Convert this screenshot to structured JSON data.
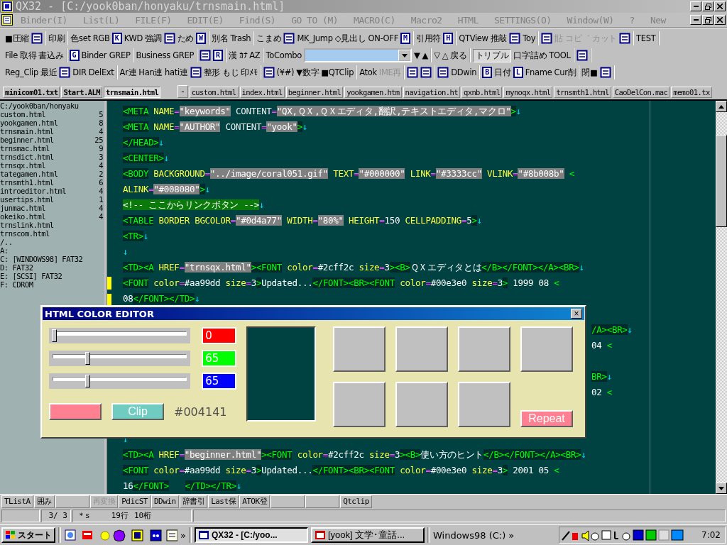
{
  "window": {
    "title": "QX32 - [C:/yook0ban/honyaku/trnsmain.html]"
  },
  "menu": [
    "Binder(I)",
    "List(L)",
    "FILE(F)",
    "EDIT(E)",
    "Find(S)",
    "GO TO (M)",
    "MACRO(C)",
    "Macro2",
    "HTML",
    "SETTINGS(O)",
    "Window(W)",
    "?",
    "New"
  ],
  "toolbars": [
    {
      "groups": [
        {
          "items": [
            {
              "kind": "text",
              "label": "■圧縮"
            },
            {
              "kind": "icon"
            }
          ]
        },
        {
          "items": [
            {
              "kind": "text",
              "label": "印刷"
            }
          ]
        },
        {
          "items": [
            {
              "kind": "text",
              "label": "色set"
            },
            {
              "kind": "text",
              "label": "RGB"
            },
            {
              "kind": "key",
              "label": "K"
            },
            {
              "kind": "text",
              "label": "KWD"
            },
            {
              "kind": "text",
              "label": "強調"
            },
            {
              "kind": "icon"
            },
            {
              "kind": "text",
              "label": "ため"
            },
            {
              "kind": "key",
              "label": "W"
            }
          ]
        },
        {
          "items": [
            {
              "kind": "text",
              "label": "別名"
            },
            {
              "kind": "text",
              "label": "Trash"
            }
          ]
        },
        {
          "items": [
            {
              "kind": "text",
              "label": "こまめ"
            },
            {
              "kind": "icon"
            },
            {
              "kind": "text",
              "label": "MK_Jump"
            },
            {
              "kind": "text",
              "label": "◇見出し"
            },
            {
              "kind": "text",
              "label": "ON-OFF"
            },
            {
              "kind": "key",
              "label": "M"
            }
          ]
        },
        {
          "items": [
            {
              "kind": "text",
              "label": "引用符"
            },
            {
              "kind": "key",
              "label": "H"
            }
          ]
        },
        {
          "items": [
            {
              "kind": "text",
              "label": "QTView"
            },
            {
              "kind": "text",
              "label": "推敲"
            },
            {
              "kind": "icon"
            },
            {
              "kind": "text",
              "label": "Toy"
            }
          ]
        },
        {
          "items": [
            {
              "kind": "icon",
              "disabled": false
            },
            {
              "kind": "text",
              "label": "貼",
              "disabled": true
            },
            {
              "kind": "text",
              "label": "コピ゛",
              "disabled": true
            },
            {
              "kind": "text",
              "label": "カット",
              "disabled": true
            },
            {
              "kind": "icon",
              "disabled": false
            }
          ]
        },
        {
          "items": [
            {
              "kind": "text",
              "label": "TEST"
            }
          ]
        }
      ]
    },
    {
      "groups": [
        {
          "items": [
            {
              "kind": "text",
              "label": "File"
            },
            {
              "kind": "text",
              "label": "取得"
            },
            {
              "kind": "text",
              "label": "書込み"
            }
          ]
        },
        {
          "items": [
            {
              "kind": "key",
              "label": "G"
            },
            {
              "kind": "text",
              "label": "Binder GREP"
            }
          ]
        },
        {
          "items": [
            {
              "kind": "text",
              "label": "Business GREP"
            }
          ]
        },
        {
          "items": [
            {
              "kind": "icon"
            },
            {
              "kind": "key",
              "label": "R"
            }
          ]
        },
        {
          "items": [
            {
              "kind": "text",
              "label": "漢"
            },
            {
              "kind": "text",
              "label": "ｶﾅ"
            },
            {
              "kind": "text",
              "label": "AZ"
            }
          ]
        },
        {
          "items": [
            {
              "kind": "text",
              "label": "ToCombo"
            },
            {
              "kind": "combo"
            },
            {
              "kind": "text",
              "label": "▼"
            },
            {
              "kind": "text",
              "label": "▲"
            }
          ]
        },
        {
          "items": [
            {
              "kind": "text",
              "label": "▽"
            },
            {
              "kind": "text",
              "label": "△"
            },
            {
              "kind": "text",
              "label": "戻る"
            }
          ]
        },
        {
          "items": [
            {
              "kind": "text",
              "label": "トリプル",
              "pressed": true
            },
            {
              "kind": "text",
              "label": "口字詰め",
              "pressed": false
            },
            {
              "kind": "text",
              "label": "TOOL",
              "pressed": false
            }
          ]
        },
        {
          "items": [
            {
              "kind": "icon"
            }
          ]
        }
      ]
    },
    {
      "groups": [
        {
          "items": [
            {
              "kind": "text",
              "label": "Reg_Clip"
            },
            {
              "kind": "text",
              "label": "最近"
            },
            {
              "kind": "icon"
            },
            {
              "kind": "text",
              "label": "DIR"
            },
            {
              "kind": "text",
              "label": "DelExt"
            }
          ]
        },
        {
          "items": [
            {
              "kind": "text",
              "label": "Ar連"
            },
            {
              "kind": "text",
              "label": "Han連"
            },
            {
              "kind": "text",
              "label": "hati連"
            },
            {
              "kind": "icon"
            },
            {
              "kind": "text",
              "label": "整形"
            },
            {
              "kind": "text",
              "label": "もじ"
            },
            {
              "kind": "text",
              "label": "印ﾒﾓ"
            }
          ]
        },
        {
          "items": [
            {
              "kind": "icon"
            },
            {
              "kind": "text",
              "label": "(¥#)"
            },
            {
              "kind": "text",
              "label": "▼数字"
            },
            {
              "kind": "text",
              "label": "■QTClip"
            }
          ]
        },
        {
          "items": [
            {
              "kind": "text",
              "label": "Atok",
              "disabled": false
            },
            {
              "kind": "text",
              "label": "IME再",
              "disabled": true
            }
          ]
        },
        {
          "items": [
            {
              "kind": "icon"
            },
            {
              "kind": "icon"
            }
          ]
        },
        {
          "items": [
            {
              "kind": "icon"
            },
            {
              "kind": "text",
              "label": "DDwin"
            }
          ]
        },
        {
          "items": [
            {
              "kind": "key",
              "label": "B"
            },
            {
              "kind": "text",
              "label": "日付"
            },
            {
              "kind": "key",
              "label": "L"
            },
            {
              "kind": "text",
              "label": "Fname"
            },
            {
              "kind": "text",
              "label": "Cur削"
            }
          ]
        },
        {
          "items": [
            {
              "kind": "text",
              "label": "閉■"
            },
            {
              "kind": "icon"
            }
          ]
        }
      ]
    }
  ],
  "tabs_left": [
    {
      "label": "minicom01.txt",
      "selected": false
    },
    {
      "label": "Start.ALM",
      "selected": false
    },
    {
      "label": "trnsmain.html",
      "selected": true
    }
  ],
  "tab_menu_button": "-",
  "tabs_right": [
    {
      "label": "custom.html",
      "selected": false
    },
    {
      "label": "index.html",
      "selected": false
    },
    {
      "label": "beginner.html",
      "selected": false
    },
    {
      "label": "yookgamen.htm",
      "selected": false
    },
    {
      "label": "navigation.ht",
      "selected": false
    },
    {
      "label": "qxnb.html",
      "selected": false
    },
    {
      "label": "mynoqx.html",
      "selected": false
    },
    {
      "label": "trnsmth1.html",
      "selected": false
    },
    {
      "label": "CaoDelCon.mac",
      "selected": false
    },
    {
      "label": "memo01.tx",
      "selected": false
    }
  ],
  "sidebar": {
    "path": "C:/yook0ban/honyaku",
    "files": [
      {
        "name": "custom.html",
        "size": "5"
      },
      {
        "name": "yookgamen.html",
        "size": "8"
      },
      {
        "name": "trnsmain.html",
        "size": "4"
      },
      {
        "name": "beginner.html",
        "size": "25"
      },
      {
        "name": "trnsmac.html",
        "size": "9"
      },
      {
        "name": "trnsdict.html",
        "size": "3"
      },
      {
        "name": "trnsqx.html",
        "size": "4"
      },
      {
        "name": "tategamen.html",
        "size": "2"
      },
      {
        "name": "trnsmth1.html",
        "size": "6"
      },
      {
        "name": "introeditor.html",
        "size": "4"
      },
      {
        "name": "usertips.html",
        "size": "1"
      },
      {
        "name": "junmac.html",
        "size": "4"
      },
      {
        "name": "okeiko.html",
        "size": "4"
      },
      {
        "name": "trnslink.html"
      },
      {
        "name": "trnscom.html"
      }
    ],
    "drives": [
      "/..",
      "A:",
      "C: [WINDOWS98] FAT32",
      "D: FAT32",
      "E: [SCSI] FAT32",
      "F: CDROM"
    ]
  },
  "editor": {
    "lines": [
      {
        "kind": "code",
        "marked": false,
        "tokens": [
          {
            "kind": "tag",
            "text": "<META"
          },
          {
            "kind": "attr",
            "text": " NAME"
          },
          {
            "kind": "eq",
            "text": "="
          },
          {
            "kind": "val",
            "text": "\"keywords\""
          },
          {
            "kind": "word",
            "text": " CONTENT"
          },
          {
            "kind": "eq",
            "text": "="
          },
          {
            "kind": "val",
            "text": "\"QX,ＱＸ,ＱＸエディタ,翻訳,テキストエディタ,マクロ\""
          },
          {
            "kind": "tag",
            "text": ">"
          },
          {
            "kind": "nl",
            "text": "↓"
          }
        ]
      },
      {
        "kind": "code",
        "marked": false,
        "tokens": [
          {
            "kind": "tag",
            "text": "<META"
          },
          {
            "kind": "attr",
            "text": " NAME"
          },
          {
            "kind": "eq",
            "text": "="
          },
          {
            "kind": "val",
            "text": "\"AUTHOR\""
          },
          {
            "kind": "word",
            "text": " CONTENT"
          },
          {
            "kind": "eq",
            "text": "="
          },
          {
            "kind": "val",
            "text": "\"yook\""
          },
          {
            "kind": "tag",
            "text": ">"
          },
          {
            "kind": "nl",
            "text": "↓"
          }
        ]
      },
      {
        "kind": "code",
        "marked": false,
        "tokens": [
          {
            "kind": "tag",
            "text": "</HEAD>"
          },
          {
            "kind": "nl",
            "text": "↓"
          }
        ]
      },
      {
        "kind": "code",
        "marked": false,
        "tokens": [
          {
            "kind": "tag",
            "text": "<CENTER>"
          },
          {
            "kind": "nl",
            "text": "↓"
          }
        ]
      },
      {
        "kind": "code",
        "marked": false,
        "tokens": [
          {
            "kind": "tag",
            "text": "<BODY"
          },
          {
            "kind": "attr",
            "text": " BACKGROUND"
          },
          {
            "kind": "eq",
            "text": "="
          },
          {
            "kind": "val",
            "text": "\"../image/coral051.gif\""
          },
          {
            "kind": "attr",
            "text": " TEXT"
          },
          {
            "kind": "eq",
            "text": "="
          },
          {
            "kind": "val",
            "text": "\"#000000\""
          },
          {
            "kind": "attr",
            "text": " LINK"
          },
          {
            "kind": "eq",
            "text": "="
          },
          {
            "kind": "val",
            "text": "\"#3333cc\""
          },
          {
            "kind": "attr",
            "text": " VLINK"
          },
          {
            "kind": "eq",
            "text": "="
          },
          {
            "kind": "val",
            "text": "\"#8b008b\""
          },
          {
            "kind": "tagplain",
            "text": " <"
          }
        ]
      },
      {
        "kind": "code",
        "marked": false,
        "tokens": [
          {
            "kind": "attr",
            "text": "ALINK"
          },
          {
            "kind": "eq",
            "text": "="
          },
          {
            "kind": "val",
            "text": "\"#008080\""
          },
          {
            "kind": "tag",
            "text": ">"
          },
          {
            "kind": "nl",
            "text": "↓"
          }
        ]
      },
      {
        "kind": "code",
        "marked": false,
        "tokens": [
          {
            "kind": "comment",
            "text": "<!-- ここからリンクボタン -->"
          },
          {
            "kind": "nl",
            "text": "↓"
          }
        ]
      },
      {
        "kind": "code",
        "marked": false,
        "tokens": [
          {
            "kind": "tag",
            "text": "<TABLE"
          },
          {
            "kind": "attr",
            "text": " BORDER BGCOLOR"
          },
          {
            "kind": "eq",
            "text": "="
          },
          {
            "kind": "val",
            "text": "\"#0d4a77\""
          },
          {
            "kind": "attr",
            "text": " WIDTH"
          },
          {
            "kind": "eq",
            "text": "="
          },
          {
            "kind": "val",
            "text": "\"80%\""
          },
          {
            "kind": "attr",
            "text": " HEIGHT"
          },
          {
            "kind": "eq",
            "text": "="
          },
          {
            "kind": "plain",
            "text": "150"
          },
          {
            "kind": "attr",
            "text": " CELLPADDING"
          },
          {
            "kind": "eq",
            "text": "="
          },
          {
            "kind": "plain",
            "text": "5"
          },
          {
            "kind": "tag",
            "text": ">"
          },
          {
            "kind": "nl",
            "text": "↓"
          }
        ]
      },
      {
        "kind": "code",
        "marked": false,
        "tokens": [
          {
            "kind": "tag",
            "text": "<TR>"
          },
          {
            "kind": "nl",
            "text": "↓"
          }
        ]
      },
      {
        "kind": "code",
        "marked": false,
        "tokens": [
          {
            "kind": "nl",
            "text": "↓"
          }
        ]
      },
      {
        "kind": "code",
        "marked": false,
        "tokens": [
          {
            "kind": "tag",
            "text": "<TD><A"
          },
          {
            "kind": "attr",
            "text": " HREF"
          },
          {
            "kind": "eq",
            "text": "="
          },
          {
            "kind": "val",
            "text": "\"trnsqx.html\""
          },
          {
            "kind": "tag",
            "text": "><FONT"
          },
          {
            "kind": "attr",
            "text": " color"
          },
          {
            "kind": "eq",
            "text": "="
          },
          {
            "kind": "plain",
            "text": "#2cff2c"
          },
          {
            "kind": "attr",
            "text": " size"
          },
          {
            "kind": "eq",
            "text": "="
          },
          {
            "kind": "plain",
            "text": "3"
          },
          {
            "kind": "tag",
            "text": "><B>"
          },
          {
            "kind": "plain",
            "text": "ＱＸエディタとは"
          },
          {
            "kind": "tag",
            "text": "</B></FONT></A><BR>"
          },
          {
            "kind": "nl",
            "text": "↓"
          }
        ]
      },
      {
        "kind": "code",
        "marked": true,
        "tokens": [
          {
            "kind": "tag",
            "text": "<FONT"
          },
          {
            "kind": "attr",
            "text": " color"
          },
          {
            "kind": "eq",
            "text": "="
          },
          {
            "kind": "plain",
            "text": "#aa99dd"
          },
          {
            "kind": "attr",
            "text": " size"
          },
          {
            "kind": "eq",
            "text": "="
          },
          {
            "kind": "plain",
            "text": "3"
          },
          {
            "kind": "tag",
            "text": ">"
          },
          {
            "kind": "plain",
            "text": "Updated..."
          },
          {
            "kind": "tag",
            "text": "</FONT><BR><FONT"
          },
          {
            "kind": "attr",
            "text": " color"
          },
          {
            "kind": "eq",
            "text": "="
          },
          {
            "kind": "plain",
            "text": "#00e3e0"
          },
          {
            "kind": "attr",
            "text": " size"
          },
          {
            "kind": "eq",
            "text": "="
          },
          {
            "kind": "plain",
            "text": "3"
          },
          {
            "kind": "tag",
            "text": ">"
          },
          {
            "kind": "plain",
            "text": " 1999 08 "
          },
          {
            "kind": "tagplain",
            "text": "<"
          }
        ]
      },
      {
        "kind": "code",
        "marked": true,
        "tokens": [
          {
            "kind": "plain",
            "text": "08"
          },
          {
            "kind": "tag",
            "text": "</FONT></TD>"
          },
          {
            "kind": "nl",
            "text": "↓"
          }
        ]
      },
      {
        "kind": "covered"
      },
      {
        "kind": "covered",
        "marked": false,
        "tokens": [
          {
            "kind": "tag",
            "text": "/A><BR>"
          },
          {
            "kind": "nl",
            "text": "↓"
          }
        ]
      },
      {
        "kind": "covered",
        "marked": false,
        "tokens": [
          {
            "kind": "plain",
            "text": "04 "
          },
          {
            "kind": "tagplain",
            "text": "<"
          }
        ]
      },
      {
        "kind": "covered"
      },
      {
        "kind": "covered",
        "marked": false,
        "tokens": [
          {
            "kind": "tag",
            "text": "BR>"
          },
          {
            "kind": "nl",
            "text": "↓"
          }
        ]
      },
      {
        "kind": "covered",
        "marked": false,
        "tokens": [
          {
            "kind": "plain",
            "text": "02 "
          },
          {
            "kind": "tagplain",
            "text": "<"
          }
        ]
      },
      {
        "kind": "covered"
      },
      {
        "kind": "covered"
      },
      {
        "kind": "code",
        "marked": false,
        "tokens": [
          {
            "kind": "nl",
            "text": "↓"
          }
        ]
      },
      {
        "kind": "code",
        "marked": false,
        "tokens": [
          {
            "kind": "tag",
            "text": "<TD><A"
          },
          {
            "kind": "attr",
            "text": " HREF"
          },
          {
            "kind": "eq",
            "text": "="
          },
          {
            "kind": "val",
            "text": "\"beginner.html\""
          },
          {
            "kind": "tag",
            "text": "><FONT"
          },
          {
            "kind": "attr",
            "text": " color"
          },
          {
            "kind": "eq",
            "text": "="
          },
          {
            "kind": "plain",
            "text": "#2cff2c"
          },
          {
            "kind": "attr",
            "text": " size"
          },
          {
            "kind": "eq",
            "text": "="
          },
          {
            "kind": "plain",
            "text": "3"
          },
          {
            "kind": "tag",
            "text": "><B>"
          },
          {
            "kind": "plain",
            "text": "使い方のヒント"
          },
          {
            "kind": "tag",
            "text": "</B></FONT></A><BR>"
          },
          {
            "kind": "nl",
            "text": "↓"
          }
        ]
      },
      {
        "kind": "code",
        "marked": false,
        "tokens": [
          {
            "kind": "tag",
            "text": "<FONT"
          },
          {
            "kind": "attr",
            "text": " color"
          },
          {
            "kind": "eq",
            "text": "="
          },
          {
            "kind": "plain",
            "text": "#aa99dd"
          },
          {
            "kind": "attr",
            "text": " size"
          },
          {
            "kind": "eq",
            "text": "="
          },
          {
            "kind": "plain",
            "text": "3"
          },
          {
            "kind": "tag",
            "text": ">"
          },
          {
            "kind": "plain",
            "text": "Updated..."
          },
          {
            "kind": "tag",
            "text": "</FONT><BR><FONT"
          },
          {
            "kind": "attr",
            "text": " color"
          },
          {
            "kind": "eq",
            "text": "="
          },
          {
            "kind": "plain",
            "text": "#00e3e0"
          },
          {
            "kind": "attr",
            "text": " size"
          },
          {
            "kind": "eq",
            "text": "="
          },
          {
            "kind": "plain",
            "text": "3"
          },
          {
            "kind": "tag",
            "text": ">"
          },
          {
            "kind": "plain",
            "text": " 2001 05 "
          },
          {
            "kind": "tagplain",
            "text": "<"
          }
        ]
      },
      {
        "kind": "code",
        "marked": false,
        "tokens": [
          {
            "kind": "plain",
            "text": "16"
          },
          {
            "kind": "tag",
            "text": "</FONT>"
          },
          {
            "kind": "tagfar",
            "text": "</TD></TR>"
          },
          {
            "kind": "nl",
            "text": "↓"
          }
        ]
      }
    ]
  },
  "color_editor": {
    "title": "HTML  COLOR EDITOR",
    "close": "×",
    "channels": [
      {
        "kind": "red",
        "level": 0,
        "value": "0"
      },
      {
        "kind": "green",
        "level": 0.255,
        "value": "65"
      },
      {
        "kind": "blue",
        "level": 0.255,
        "value": "65"
      }
    ],
    "hex": "#004141",
    "clip": "Clip",
    "repeat": "Repeat",
    "swatches": [
      {
        "color": "#c0c0c0"
      },
      {
        "color": "#c0c0c0"
      },
      {
        "color": "#c0c0c0"
      },
      {
        "color": "#c0c0c0"
      },
      {
        "color": "#c0c0c0"
      },
      {
        "color": "#c0c0c0"
      },
      {
        "color": "#c0c0c0"
      }
    ]
  },
  "status_buttons": [
    {
      "kind": "button",
      "label": "TListA",
      "disabled": false
    },
    {
      "kind": "button",
      "label": "囲み",
      "disabled": false
    },
    {
      "kind": "blank"
    },
    {
      "kind": "button",
      "label": "再変換",
      "disabled": true
    },
    {
      "kind": "button",
      "label": "PdicST",
      "disabled": false
    },
    {
      "kind": "button",
      "label": "DDwin",
      "disabled": false
    },
    {
      "kind": "button",
      "label": "辞書引",
      "disabled": false
    },
    {
      "kind": "button",
      "label": "Last保",
      "disabled": false
    },
    {
      "kind": "button",
      "label": "ATOK登",
      "disabled": false
    },
    {
      "kind": "blank"
    },
    {
      "kind": "blank"
    },
    {
      "kind": "button",
      "label": "Qtclip",
      "disabled": false
    }
  ],
  "status_bar": {
    "page": "3/ 3",
    "mode": "＊s",
    "line": "19行",
    "column": "10桁"
  },
  "taskbar": {
    "start": "スタート",
    "more": "»",
    "tasks": [
      {
        "label": "QX32 - [C:/yoo...",
        "selected": true
      },
      {
        "label": "[yook] 文学･童話...",
        "selected": false
      }
    ],
    "folder": "Windows98 (C:)",
    "folder_more": "»",
    "clock": "7:02"
  }
}
